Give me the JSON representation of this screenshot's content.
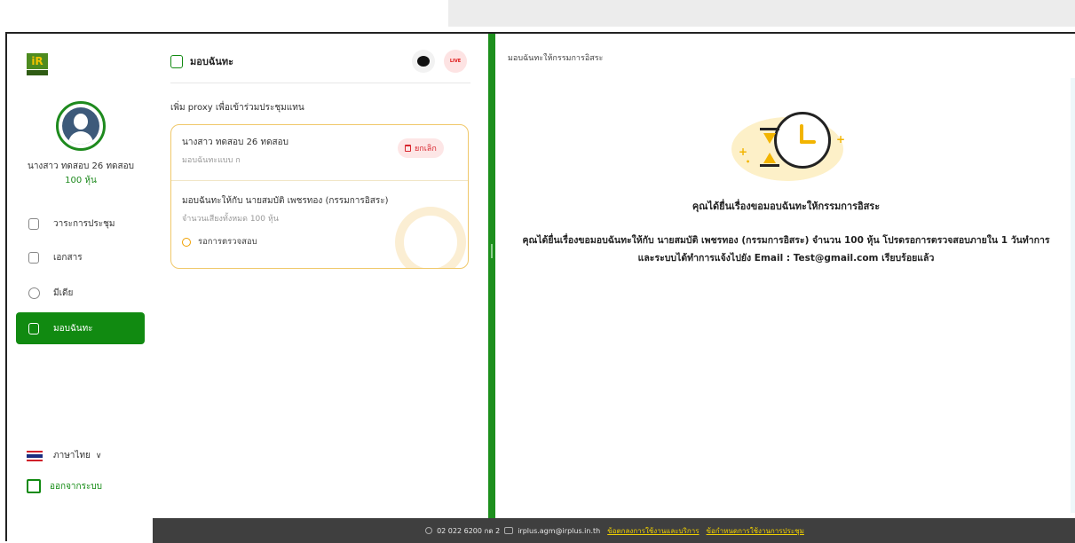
{
  "sidebar": {
    "logo_text": "iR",
    "user_name": "นางสาว ทดสอบ 26 ทดสอบ",
    "user_shares": "100 หุ้น",
    "nav": [
      {
        "label": "วาระการประชุม",
        "icon": "agenda-icon"
      },
      {
        "label": "เอกสาร",
        "icon": "folder-icon"
      },
      {
        "label": "มีเดีย",
        "icon": "play-icon"
      },
      {
        "label": "มอบฉันทะ",
        "icon": "proxy-doc-icon",
        "active": true
      }
    ],
    "language": "ภาษาไทย",
    "logout": "ออกจากระบบ"
  },
  "middle": {
    "title": "มอบฉันทะ",
    "live_badge": "LIVE",
    "proxy_label": "เพิ่ม proxy เพื่อเข้าร่วมประชุมแทน",
    "card": {
      "name": "นางสาว ทดสอบ 26 ทดสอบ",
      "type": "มอบฉันทะแบบ ก",
      "cancel_label": "ยกเลิก",
      "to": "มอบฉันทะให้กับ นายสมบัติ เพชรทอง (กรรมการอิสระ)",
      "votes": "จำนวนเสียงทั้งหมด 100 หุ้น",
      "status": "รอการตรวจสอบ"
    }
  },
  "right": {
    "title": "มอบฉันทะให้กรรมการอิสระ",
    "message_title": "คุณได้ยื่นเรื่องขอมอบฉันทะให้กรรมการอิสระ",
    "message_body": "คุณได้ยื่นเรื่องขอมอบฉันทะให้กับ นายสมบัติ เพชรทอง (กรรมการอิสระ) จำนวน 100 หุ้น โปรดรอการตรวจสอบภายใน 1 วันทำการ และระบบได้ทำการแจ้งไปยัง Email : Test@gmail.com เรียบร้อยแล้ว"
  },
  "footer": {
    "phone": "02 022 6200 กด 2",
    "email": "irplus.agm@irplus.in.th",
    "terms_link": "ข้อตกลงการใช้งานและบริการ",
    "rules_link": "ข้อกำหนดการใช้งานการประชุม"
  },
  "colors": {
    "primary_green": "#118a11",
    "cancel_red": "#d8262e",
    "accent_gold": "#f2b400",
    "footer_bg": "#3f3f3f"
  }
}
